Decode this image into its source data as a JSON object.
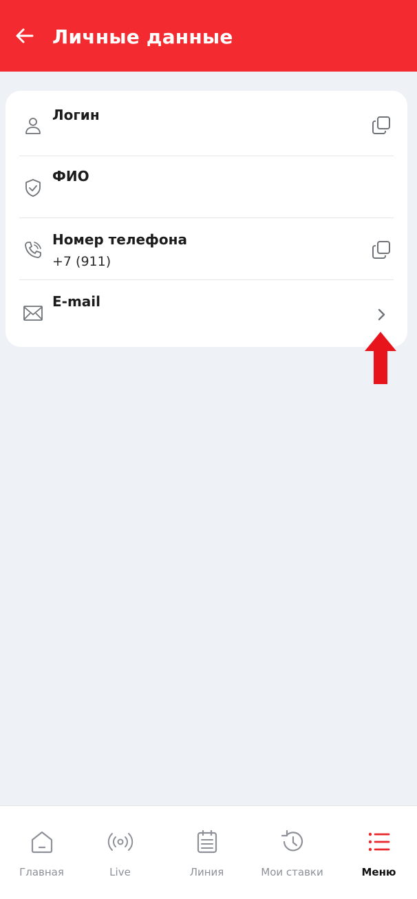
{
  "header": {
    "title": "Личные данные",
    "back_icon": "arrow-left-icon",
    "background_color": "#f32a2f"
  },
  "fields": [
    {
      "label": "Логин",
      "value": "",
      "icon": "user-icon",
      "action_icon": "copy-icon"
    },
    {
      "label": "ФИО",
      "value": "",
      "icon": "shield-check-icon",
      "action_icon": ""
    },
    {
      "label": "Номер телефона",
      "value": "+7 (911)",
      "icon": "phone-icon",
      "action_icon": "copy-icon"
    },
    {
      "label": "E-mail",
      "value": "",
      "icon": "envelope-icon",
      "action_icon": "chevron-right-icon"
    }
  ],
  "annotation": {
    "icon": "red-arrow-up-icon",
    "color": "#e8141b"
  },
  "bottom_nav": {
    "items": [
      {
        "label": "Главная",
        "icon": "home-icon",
        "active": false
      },
      {
        "label": "Live",
        "icon": "broadcast-icon",
        "active": false
      },
      {
        "label": "Линия",
        "icon": "calendar-icon",
        "active": false
      },
      {
        "label": "Мои ставки",
        "icon": "history-icon",
        "active": false
      },
      {
        "label": "Меню",
        "icon": "menu-list-icon",
        "active": true
      }
    ],
    "inactive_color": "#8d9097",
    "active_icon_color": "#e8262c"
  }
}
